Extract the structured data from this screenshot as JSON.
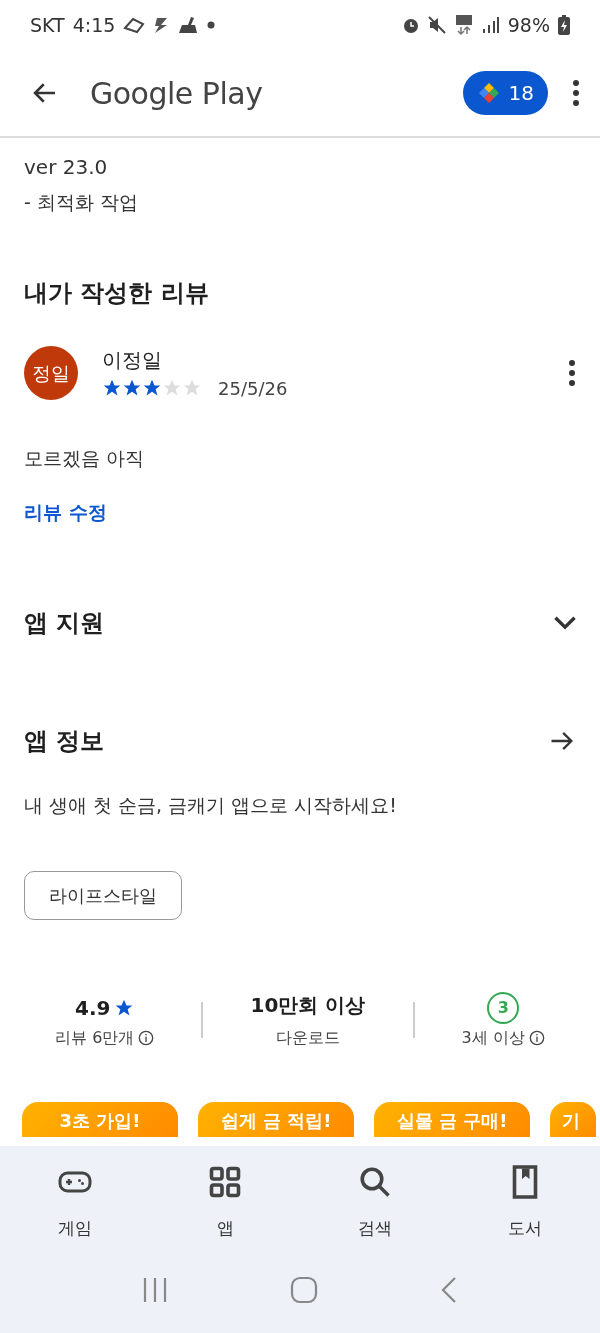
{
  "status_bar": {
    "carrier": "SKT",
    "time": "4:15",
    "battery": "98%"
  },
  "app_bar": {
    "title": "Google Play",
    "points": "18"
  },
  "whats_new": {
    "version": "ver 23.0",
    "note": "- 최적화 작업"
  },
  "my_review": {
    "heading": "내가 작성한 리뷰",
    "avatar": "정일",
    "author": "이정일",
    "stars": 3,
    "date": "25/5/26",
    "text": "모르겠음 아직",
    "edit_link": "리뷰 수정"
  },
  "app_support": {
    "heading": "앱 지원",
    "expanded": false
  },
  "app_info": {
    "heading": "앱 정보",
    "description": "내 생애 첫 순금, 금캐기 앱으로 시작하세요!",
    "category": "라이프스타일"
  },
  "stats": [
    {
      "kind": "rating",
      "value": "4.9",
      "label": "리뷰 6만개"
    },
    {
      "kind": "downloads",
      "value": "10만회 이상",
      "label": "다운로드"
    },
    {
      "kind": "age",
      "value": "3",
      "label": "3세 이상"
    }
  ],
  "screenshots": [
    {
      "caption": "3초 가입!"
    },
    {
      "caption": "쉽게 금 적립!"
    },
    {
      "caption": "실물 금 구매!"
    },
    {
      "caption": "기"
    }
  ],
  "bottom_nav": [
    {
      "label": "게임"
    },
    {
      "label": "앱"
    },
    {
      "label": "검색"
    },
    {
      "label": "도서"
    }
  ]
}
